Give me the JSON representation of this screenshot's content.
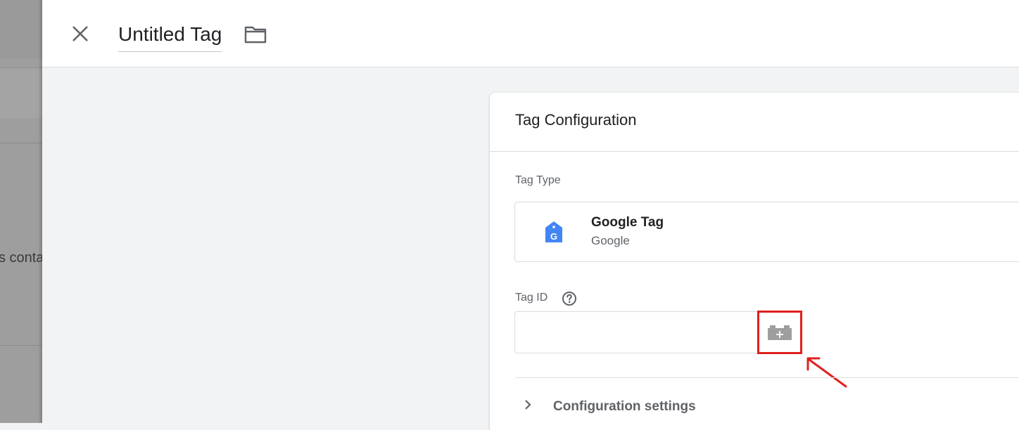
{
  "background": {
    "partial_text": "s conta"
  },
  "header": {
    "close_icon": "close-icon",
    "tag_name": "Untitled Tag",
    "folder_icon": "folder-icon"
  },
  "card": {
    "title": "Tag Configuration",
    "tag_type": {
      "label": "Tag Type",
      "name": "Google Tag",
      "vendor": "Google",
      "icon": "google-tag-icon",
      "icon_color": "#4285f4"
    },
    "tag_id": {
      "label": "Tag ID",
      "help_icon": "help-circle-icon",
      "value": "",
      "variable_icon": "variable-brick-icon"
    },
    "config_settings": {
      "label": "Configuration settings",
      "icon": "chevron-right-icon"
    }
  },
  "colors": {
    "highlight_red": "#e0201c",
    "panel_bg": "#f1f3f4"
  }
}
